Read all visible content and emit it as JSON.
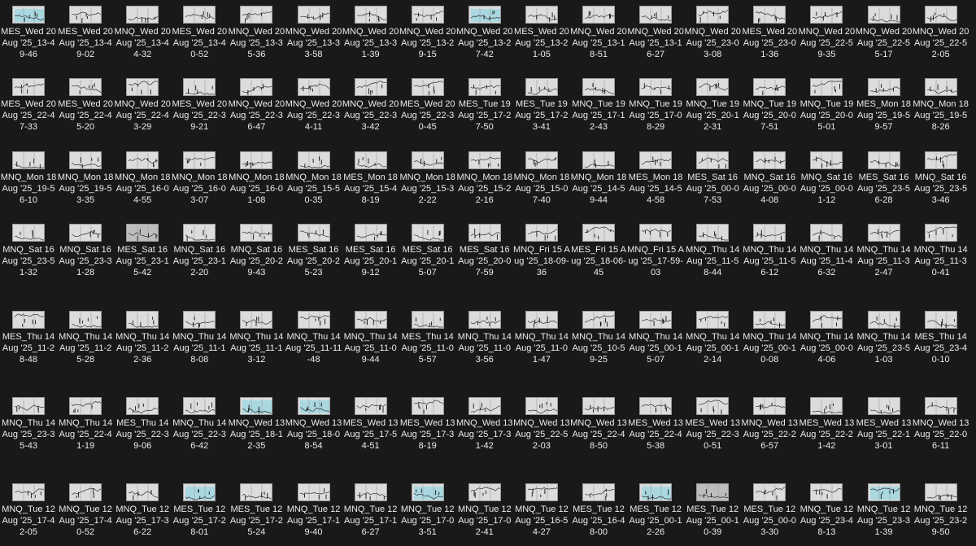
{
  "files": [
    {
      "name": "MES_Wed 20 Aug '25_13-49-46",
      "thumb": "cyan"
    },
    {
      "name": "MES_Wed 20 Aug '25_13-49-02",
      "thumb": "chart"
    },
    {
      "name": "MNQ_Wed 20 Aug '25_13-44-32",
      "thumb": "chart"
    },
    {
      "name": "MES_Wed 20 Aug '25_13-40-52",
      "thumb": "chart"
    },
    {
      "name": "MNQ_Wed 20 Aug '25_13-35-36",
      "thumb": "chart"
    },
    {
      "name": "MNQ_Wed 20 Aug '25_13-33-58",
      "thumb": "chart"
    },
    {
      "name": "MNQ_Wed 20 Aug '25_13-31-39",
      "thumb": "chart"
    },
    {
      "name": "MNQ_Wed 20 Aug '25_13-29-15",
      "thumb": "chart"
    },
    {
      "name": "MNQ_Wed 20 Aug '25_13-27-42",
      "thumb": "cyan"
    },
    {
      "name": "MES_Wed 20 Aug '25_13-21-05",
      "thumb": "chart"
    },
    {
      "name": "MNQ_Wed 20 Aug '25_13-18-51",
      "thumb": "chart"
    },
    {
      "name": "MNQ_Wed 20 Aug '25_13-16-27",
      "thumb": "chart"
    },
    {
      "name": "MNQ_Wed 20 Aug '25_23-03-08",
      "thumb": "chart"
    },
    {
      "name": "MES_Wed 20 Aug '25_23-01-36",
      "thumb": "chart"
    },
    {
      "name": "MNQ_Wed 20 Aug '25_22-59-35",
      "thumb": "chart"
    },
    {
      "name": "MNQ_Wed 20 Aug '25_22-55-17",
      "thumb": "chart"
    },
    {
      "name": "MNQ_Wed 20 Aug '25_22-52-05",
      "thumb": "chart"
    },
    {
      "name": "MES_Wed 20 Aug '25_22-47-33",
      "thumb": "chart"
    },
    {
      "name": "MES_Wed 20 Aug '25_22-45-20",
      "thumb": "chart"
    },
    {
      "name": "MNQ_Wed 20 Aug '25_22-43-29",
      "thumb": "chart"
    },
    {
      "name": "MES_Wed 20 Aug '25_22-39-21",
      "thumb": "chart"
    },
    {
      "name": "MNQ_Wed 20 Aug '25_22-36-47",
      "thumb": "chart"
    },
    {
      "name": "MNQ_Wed 20 Aug '25_22-34-11",
      "thumb": "chart"
    },
    {
      "name": "MNQ_Wed 20 Aug '25_22-33-42",
      "thumb": "chart"
    },
    {
      "name": "MES_Wed 20 Aug '25_22-30-45",
      "thumb": "chart"
    },
    {
      "name": "MES_Tue 19 Aug '25_17-27-50",
      "thumb": "chart"
    },
    {
      "name": "MES_Tue 19 Aug '25_17-23-41",
      "thumb": "chart"
    },
    {
      "name": "MNQ_Tue 19 Aug '25_17-12-43",
      "thumb": "chart"
    },
    {
      "name": "MNQ_Tue 19 Aug '25_17-08-29",
      "thumb": "chart"
    },
    {
      "name": "MNQ_Tue 19 Aug '25_20-12-31",
      "thumb": "chart"
    },
    {
      "name": "MNQ_Tue 19 Aug '25_20-07-51",
      "thumb": "chart"
    },
    {
      "name": "MNQ_Tue 19 Aug '25_20-05-01",
      "thumb": "chart"
    },
    {
      "name": "MES_Mon 18 Aug '25_19-59-57",
      "thumb": "chart"
    },
    {
      "name": "MNQ_Mon 18 Aug '25_19-58-26",
      "thumb": "chart"
    },
    {
      "name": "MNQ_Mon 18 Aug '25_19-56-10",
      "thumb": "chart"
    },
    {
      "name": "MNQ_Mon 18 Aug '25_19-53-35",
      "thumb": "chart"
    },
    {
      "name": "MNQ_Mon 18 Aug '25_16-04-55",
      "thumb": "chart"
    },
    {
      "name": "MNQ_Mon 18 Aug '25_16-03-07",
      "thumb": "chart"
    },
    {
      "name": "MNQ_Mon 18 Aug '25_16-01-08",
      "thumb": "chart"
    },
    {
      "name": "MNQ_Mon 18 Aug '25_15-50-35",
      "thumb": "chart"
    },
    {
      "name": "MES_Mon 18 Aug '25_15-48-19",
      "thumb": "chart"
    },
    {
      "name": "MNQ_Mon 18 Aug '25_15-32-22",
      "thumb": "chart"
    },
    {
      "name": "MNQ_Mon 18 Aug '25_15-22-16",
      "thumb": "chart"
    },
    {
      "name": "MNQ_Mon 18 Aug '25_15-07-40",
      "thumb": "chart"
    },
    {
      "name": "MNQ_Mon 18 Aug '25_14-59-44",
      "thumb": "chart"
    },
    {
      "name": "MES_Mon 18 Aug '25_14-54-58",
      "thumb": "chart"
    },
    {
      "name": "MES_Sat 16 Aug '25_00-07-53",
      "thumb": "chart"
    },
    {
      "name": "MNQ_Sat 16 Aug '25_00-04-08",
      "thumb": "chart"
    },
    {
      "name": "MNQ_Sat 16 Aug '25_00-01-12",
      "thumb": "chart"
    },
    {
      "name": "MES_Sat 16 Aug '25_23-56-28",
      "thumb": "chart"
    },
    {
      "name": "MNQ_Sat 16 Aug '25_23-53-46",
      "thumb": "chart"
    },
    {
      "name": "MNQ_Sat 16 Aug '25_23-51-32",
      "thumb": "chart"
    },
    {
      "name": "MNQ_Sat 16 Aug '25_23-31-28",
      "thumb": "chart"
    },
    {
      "name": "MES_Sat 16 Aug '25_23-15-42",
      "thumb": "grey"
    },
    {
      "name": "MNQ_Sat 16 Aug '25_23-12-20",
      "thumb": "chart"
    },
    {
      "name": "MNQ_Sat 16 Aug '25_20-29-43",
      "thumb": "chart"
    },
    {
      "name": "MES_Sat 16 Aug '25_20-25-23",
      "thumb": "chart"
    },
    {
      "name": "MES_Sat 16 Aug '25_20-19-12",
      "thumb": "chart"
    },
    {
      "name": "MES_Sat 16 Aug '25_20-15-07",
      "thumb": "chart"
    },
    {
      "name": "MES_Sat 16 Aug '25_20-07-59",
      "thumb": "chart"
    },
    {
      "name": "MNQ_Fri 15 Aug '25_18-09-36",
      "thumb": "chart"
    },
    {
      "name": "MES_Fri 15 Aug '25_18-06-45",
      "thumb": "chart"
    },
    {
      "name": "MNQ_Fri 15 Aug '25_17-59-03",
      "thumb": "chart"
    },
    {
      "name": "MNQ_Thu 14 Aug '25_11-58-44",
      "thumb": "chart"
    },
    {
      "name": "MNQ_Thu 14 Aug '25_11-56-12",
      "thumb": "chart"
    },
    {
      "name": "MNQ_Thu 14 Aug '25_11-46-32",
      "thumb": "chart"
    },
    {
      "name": "MNQ_Thu 14 Aug '25_11-32-47",
      "thumb": "chart"
    },
    {
      "name": "MNQ_Thu 14 Aug '25_11-30-41",
      "thumb": "chart"
    },
    {
      "name": "MES_Thu 14 Aug '25_11-28-48",
      "thumb": "chart"
    },
    {
      "name": "MNQ_Thu 14 Aug '25_11-25-28",
      "thumb": "chart"
    },
    {
      "name": "MNQ_Thu 14 Aug '25_11-22-36",
      "thumb": "chart"
    },
    {
      "name": "MNQ_Thu 14 Aug '25_11-18-08",
      "thumb": "chart"
    },
    {
      "name": "MNQ_Thu 14 Aug '25_11-13-12",
      "thumb": "chart"
    },
    {
      "name": "MNQ_Thu 14 Aug '25_11-11-48",
      "thumb": "chart"
    },
    {
      "name": "MNQ_Thu 14 Aug '25_11-09-44",
      "thumb": "chart"
    },
    {
      "name": "MES_Thu 14 Aug '25_11-05-57",
      "thumb": "chart"
    },
    {
      "name": "MNQ_Thu 14 Aug '25_11-03-56",
      "thumb": "chart"
    },
    {
      "name": "MNQ_Thu 14 Aug '25_11-01-47",
      "thumb": "chart"
    },
    {
      "name": "MNQ_Thu 14 Aug '25_10-59-25",
      "thumb": "chart"
    },
    {
      "name": "MNQ_Thu 14 Aug '25_00-15-07",
      "thumb": "chart"
    },
    {
      "name": "MNQ_Thu 14 Aug '25_00-12-14",
      "thumb": "chart"
    },
    {
      "name": "MNQ_Thu 14 Aug '25_00-10-08",
      "thumb": "chart"
    },
    {
      "name": "MNQ_Thu 14 Aug '25_00-04-06",
      "thumb": "chart"
    },
    {
      "name": "MNQ_Thu 14 Aug '25_23-51-03",
      "thumb": "chart"
    },
    {
      "name": "MES_Thu 14 Aug '25_23-40-10",
      "thumb": "chart"
    },
    {
      "name": "MNQ_Thu 14 Aug '25_23-35-43",
      "thumb": "chart"
    },
    {
      "name": "MNQ_Thu 14 Aug '25_22-41-19",
      "thumb": "chart"
    },
    {
      "name": "MES_Thu 14 Aug '25_22-39-06",
      "thumb": "chart"
    },
    {
      "name": "MNQ_Thu 14 Aug '25_22-36-42",
      "thumb": "chart"
    },
    {
      "name": "MNQ_Wed 13 Aug '25_18-12-35",
      "thumb": "cyan"
    },
    {
      "name": "MNQ_Wed 13 Aug '25_18-08-54",
      "thumb": "cyan"
    },
    {
      "name": "MES_Wed 13 Aug '25_17-54-51",
      "thumb": "chart"
    },
    {
      "name": "MES_Wed 13 Aug '25_17-38-19",
      "thumb": "chart"
    },
    {
      "name": "MNQ_Wed 13 Aug '25_17-31-42",
      "thumb": "chart"
    },
    {
      "name": "MNQ_Wed 13 Aug '25_22-52-03",
      "thumb": "chart"
    },
    {
      "name": "MNQ_Wed 13 Aug '25_22-48-50",
      "thumb": "chart"
    },
    {
      "name": "MES_Wed 13 Aug '25_22-45-38",
      "thumb": "chart"
    },
    {
      "name": "MES_Wed 13 Aug '25_22-30-51",
      "thumb": "chart"
    },
    {
      "name": "MNQ_Wed 13 Aug '25_22-26-57",
      "thumb": "chart"
    },
    {
      "name": "MES_Wed 13 Aug '25_22-21-42",
      "thumb": "chart"
    },
    {
      "name": "MES_Wed 13 Aug '25_22-13-01",
      "thumb": "chart"
    },
    {
      "name": "MNQ_Wed 13 Aug '25_22-06-11",
      "thumb": "chart"
    },
    {
      "name": "MNQ_Tue 12 Aug '25_17-42-05",
      "thumb": "chart"
    },
    {
      "name": "MNQ_Tue 12 Aug '25_17-40-52",
      "thumb": "chart"
    },
    {
      "name": "MNQ_Tue 12 Aug '25_17-36-22",
      "thumb": "chart"
    },
    {
      "name": "MES_Tue 12 Aug '25_17-28-01",
      "thumb": "cyan"
    },
    {
      "name": "MES_Tue 12 Aug '25_17-25-24",
      "thumb": "chart"
    },
    {
      "name": "MNQ_Tue 12 Aug '25_17-19-40",
      "thumb": "chart"
    },
    {
      "name": "MNQ_Tue 12 Aug '25_17-16-27",
      "thumb": "chart"
    },
    {
      "name": "MNQ_Tue 12 Aug '25_17-03-51",
      "thumb": "cyan"
    },
    {
      "name": "MNQ_Tue 12 Aug '25_17-02-41",
      "thumb": "chart"
    },
    {
      "name": "MNQ_Tue 12 Aug '25_16-54-27",
      "thumb": "chart"
    },
    {
      "name": "MES_Tue 12 Aug '25_16-48-00",
      "thumb": "chart"
    },
    {
      "name": "MES_Tue 12 Aug '25_00-12-26",
      "thumb": "cyan"
    },
    {
      "name": "MES_Tue 12 Aug '25_00-10-39",
      "thumb": "grey"
    },
    {
      "name": "MES_Tue 12 Aug '25_00-03-30",
      "thumb": "chart"
    },
    {
      "name": "MNQ_Tue 12 Aug '25_23-48-13",
      "thumb": "chart"
    },
    {
      "name": "MNQ_Tue 12 Aug '25_23-31-39",
      "thumb": "cyan"
    },
    {
      "name": "MNQ_Tue 12 Aug '25_23-29-50",
      "thumb": "chart"
    }
  ]
}
